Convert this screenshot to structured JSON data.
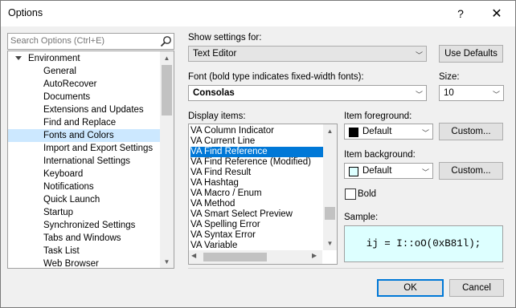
{
  "window": {
    "title": "Options",
    "help_label": "?",
    "close_label": "✕"
  },
  "search": {
    "placeholder": "Search Options (Ctrl+E)",
    "icon": "search-icon"
  },
  "tree": {
    "items": [
      {
        "label": "Environment",
        "expanded": true
      },
      {
        "label": "General"
      },
      {
        "label": "AutoRecover"
      },
      {
        "label": "Documents"
      },
      {
        "label": "Extensions and Updates"
      },
      {
        "label": "Find and Replace"
      },
      {
        "label": "Fonts and Colors",
        "selected": true
      },
      {
        "label": "Import and Export Settings"
      },
      {
        "label": "International Settings"
      },
      {
        "label": "Keyboard"
      },
      {
        "label": "Notifications"
      },
      {
        "label": "Quick Launch"
      },
      {
        "label": "Startup"
      },
      {
        "label": "Synchronized Settings"
      },
      {
        "label": "Tabs and Windows"
      },
      {
        "label": "Task List"
      },
      {
        "label": "Web Browser"
      }
    ]
  },
  "settings": {
    "show_for_label": "Show settings for:",
    "show_for_value": "Text Editor",
    "use_defaults_label": "Use Defaults",
    "font_label": "Font (bold type indicates fixed-width fonts):",
    "font_value": "Consolas",
    "size_label": "Size:",
    "size_value": "10"
  },
  "display_items": {
    "label": "Display items:",
    "items": [
      "VA Column Indicator",
      "VA Current Line",
      "VA Find Reference",
      "VA Find Reference (Modified)",
      "VA Find Result",
      "VA Hashtag",
      "VA Macro / Enum",
      "VA Method",
      "VA Smart Select Preview",
      "VA Spelling Error",
      "VA Syntax Error",
      "VA Variable"
    ],
    "selected_index": 2
  },
  "foreground": {
    "label": "Item foreground:",
    "value": "Default",
    "swatch_color": "#000000",
    "custom_label": "Custom..."
  },
  "background": {
    "label": "Item background:",
    "value": "Default",
    "swatch_color": "#ddffff",
    "custom_label": "Custom..."
  },
  "bold": {
    "label": "Bold",
    "checked": false
  },
  "sample": {
    "label": "Sample:",
    "text": "ij = I::oO(0xB81l);"
  },
  "footer": {
    "ok_label": "OK",
    "cancel_label": "Cancel"
  }
}
